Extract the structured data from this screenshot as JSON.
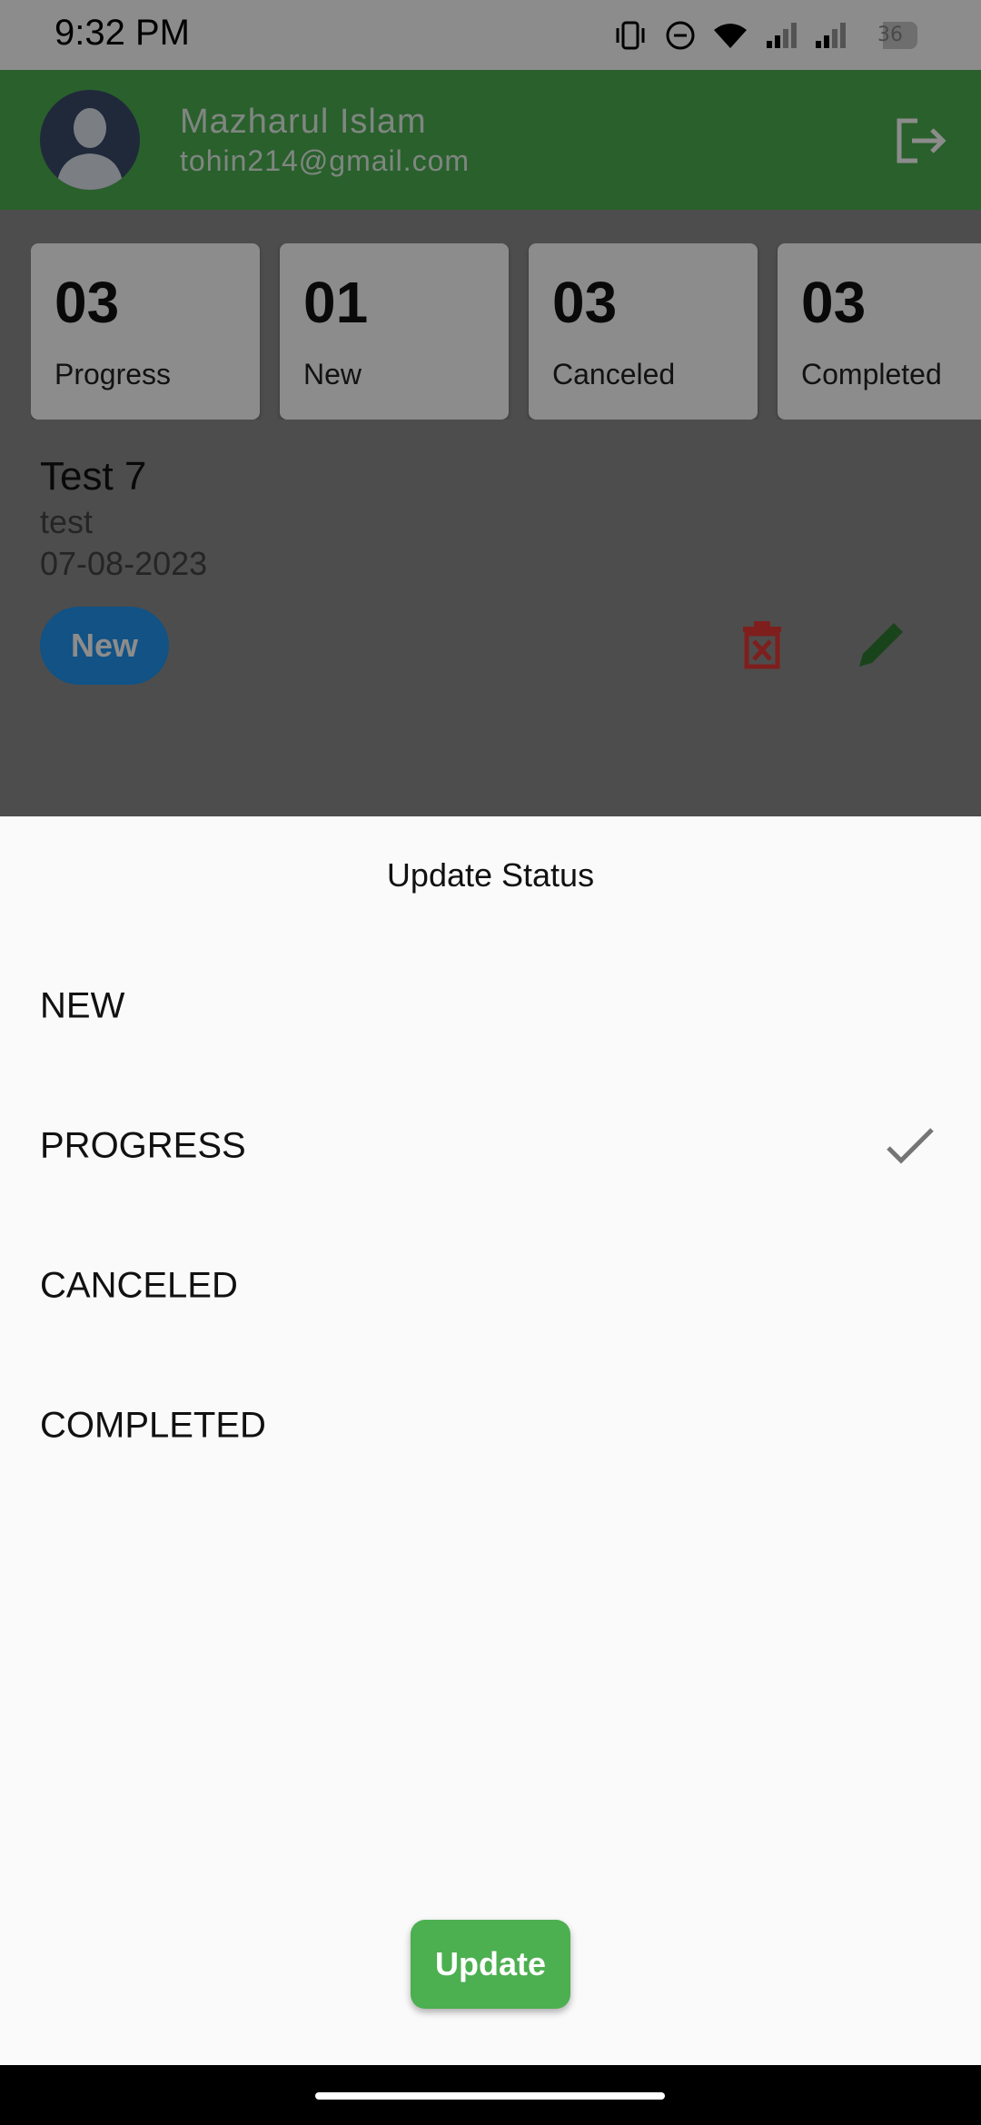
{
  "status_bar": {
    "time": "9:32 PM",
    "battery": "36"
  },
  "header": {
    "name": "Mazharul Islam",
    "email": "tohin214@gmail.com"
  },
  "summary": [
    {
      "count": "03",
      "label": "Progress"
    },
    {
      "count": "01",
      "label": "New"
    },
    {
      "count": "03",
      "label": "Canceled"
    },
    {
      "count": "03",
      "label": "Completed"
    }
  ],
  "task": {
    "title": "Test 7",
    "description": "test",
    "date": "07-08-2023",
    "status": "New"
  },
  "sheet": {
    "title": "Update Status",
    "options": [
      "NEW",
      "PROGRESS",
      "CANCELED",
      "COMPLETED"
    ],
    "selected_index": 1,
    "update_label": "Update"
  },
  "colors": {
    "primary": "#4caf50",
    "chip": "#2196f3",
    "delete": "#e53935",
    "edit": "#2e7d32"
  }
}
